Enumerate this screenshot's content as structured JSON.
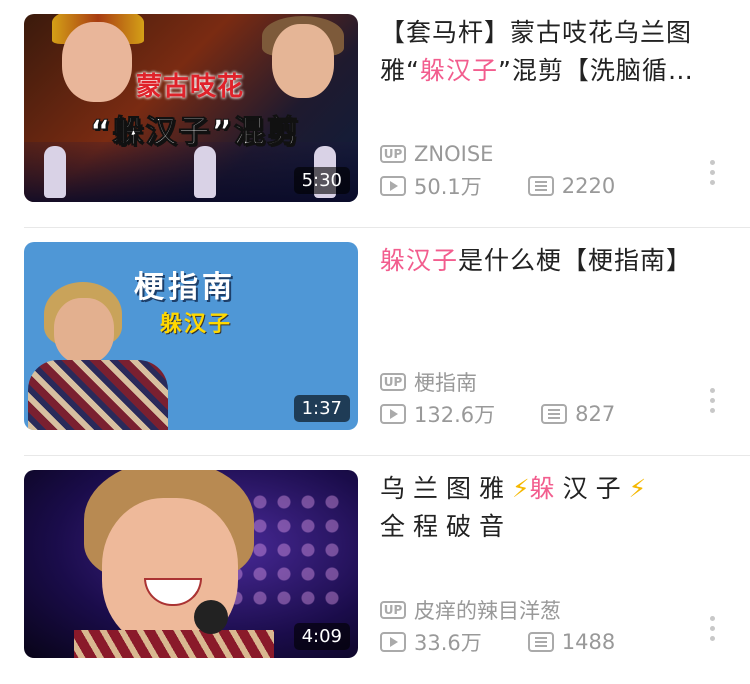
{
  "videos": [
    {
      "title_prefix": "【套马杆】蒙古吱花乌兰图雅“",
      "title_highlight": "躲汉子",
      "title_suffix": "”混剪【洗脑循…",
      "duration": "5:30",
      "uploader": "ZNOISE",
      "views": "50.1万",
      "danmaku": "2220",
      "thumb_text_top": "蒙古吱花",
      "thumb_text_main": "“躲汉子”混剪"
    },
    {
      "title_prefix": "",
      "title_highlight": "躲汉子",
      "title_suffix": "是什么梗【梗指南】",
      "duration": "1:37",
      "uploader": "梗指南",
      "views": "132.6万",
      "danmaku": "827",
      "thumb_text_top": "梗指南",
      "thumb_text_main": "躲汉子"
    },
    {
      "title_prefix": "乌兰图雅",
      "title_bolt": "⚡",
      "title_highlight": "躲",
      "title_suffix": "汉子",
      "title_line2": "全程破音",
      "duration": "4:09",
      "uploader": "皮痒的辣目洋葱",
      "views": "33.6万",
      "danmaku": "1488"
    }
  ],
  "badges": {
    "up": "UP"
  },
  "icons": {
    "play": "play-icon",
    "danmaku": "danmaku-icon",
    "more": "more-icon"
  },
  "colors": {
    "highlight": "#f25d8e",
    "meta": "#999999",
    "bolt": "#f5b800"
  }
}
